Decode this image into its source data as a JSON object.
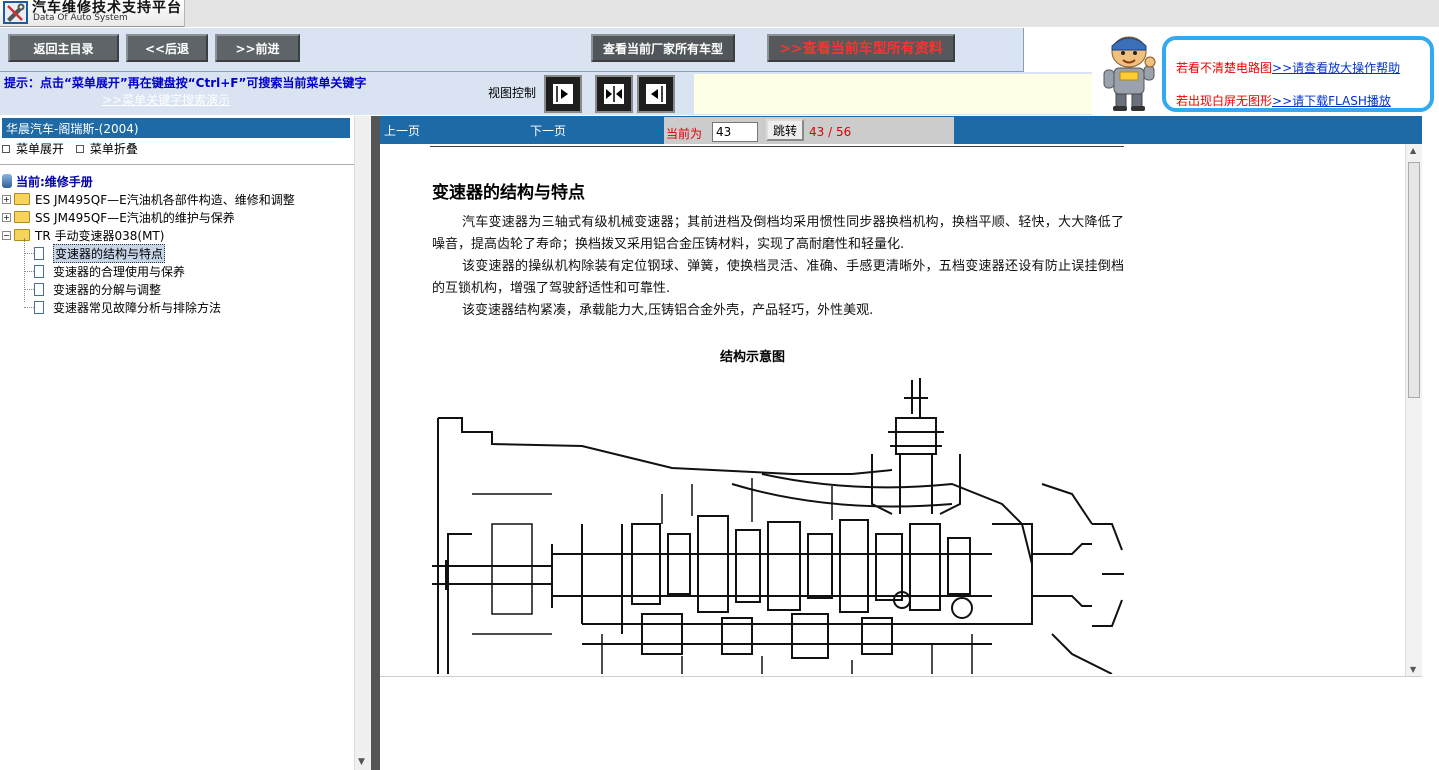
{
  "app": {
    "title": "汽车维修技术支持平台",
    "subtitle": "Data Of Auto System"
  },
  "nav": {
    "home_label": "返回主目录",
    "back_label": "<<后退",
    "forward_label": ">>前进",
    "models_label": "查看当前厂家所有车型",
    "all_label": ">>查看当前车型所有资料"
  },
  "hint": {
    "text": "提示：点击“菜单展开”再在键盘按“Ctrl+F”可搜索当前菜单关键字",
    "link": ">>菜单关键字搜索演示",
    "view_label": "视图控制"
  },
  "help": {
    "line1_text": "若看不清楚电路图",
    "line1_link": ">>请查看放大操作帮助",
    "line2_text": "若出现白屏无图形",
    "line2_link": ">>请下载FLASH播放"
  },
  "left": {
    "vehicle_title": "华晨汽车-阁瑞斯-(2004)",
    "expand_label": "菜单展开",
    "collapse_label": "菜单折叠",
    "current_label": "当前:维修手册",
    "folders": [
      {
        "label": "ES JM495QF—E汽油机各部件构造、维修和调整"
      },
      {
        "label": "SS JM495QF—E汽油机的维护与保养"
      },
      {
        "label": "TR 手动变速器038(MT)"
      }
    ],
    "docs": [
      {
        "label": "变速器的结构与特点"
      },
      {
        "label": "变速器的合理使用与保养"
      },
      {
        "label": "变速器的分解与调整"
      },
      {
        "label": "变速器常见故障分析与排除方法"
      }
    ]
  },
  "pager": {
    "prev_label": "上一页",
    "next_label": "下一页",
    "current_label": "当前为",
    "current_value": "43",
    "jump_label": "跳转",
    "count": "43 / 56"
  },
  "document": {
    "title": "变速器的结构与特点",
    "paragraphs": [
      "汽车变速器为三轴式有级机械变速器；其前进档及倒档均采用惯性同步器换档机构，换档平顺、轻快，大大降低了噪音，提高齿轮了寿命；换档拨叉采用铝合金压铸材料，实现了高耐磨性和轻量化.",
      "该变速器的操纵机构除装有定位钢球、弹簧，使换档灵活、准确、手感更清晰外，五档变速器还设有防止误挂倒档的互锁机构，增强了驾驶舒适性和可靠性.",
      "该变速器结构紧凑，承载能力大,压铸铝合金外壳，产品轻巧，外性美观."
    ],
    "figure_caption": "结构示意图"
  },
  "icons": {
    "logo": "wrench-logo-icon",
    "mascot": "mechanic-mascot-icon",
    "folder": "folder-icon",
    "doc": "document-icon",
    "db": "database-icon"
  },
  "colors": {
    "accent_blue": "#1e6aa6",
    "nav_bg": "#d9e3f2",
    "button_dark": "#5e6467",
    "hint_blue": "#0000cc",
    "alert_red": "#dd0000",
    "help_border": "#33aaee"
  }
}
